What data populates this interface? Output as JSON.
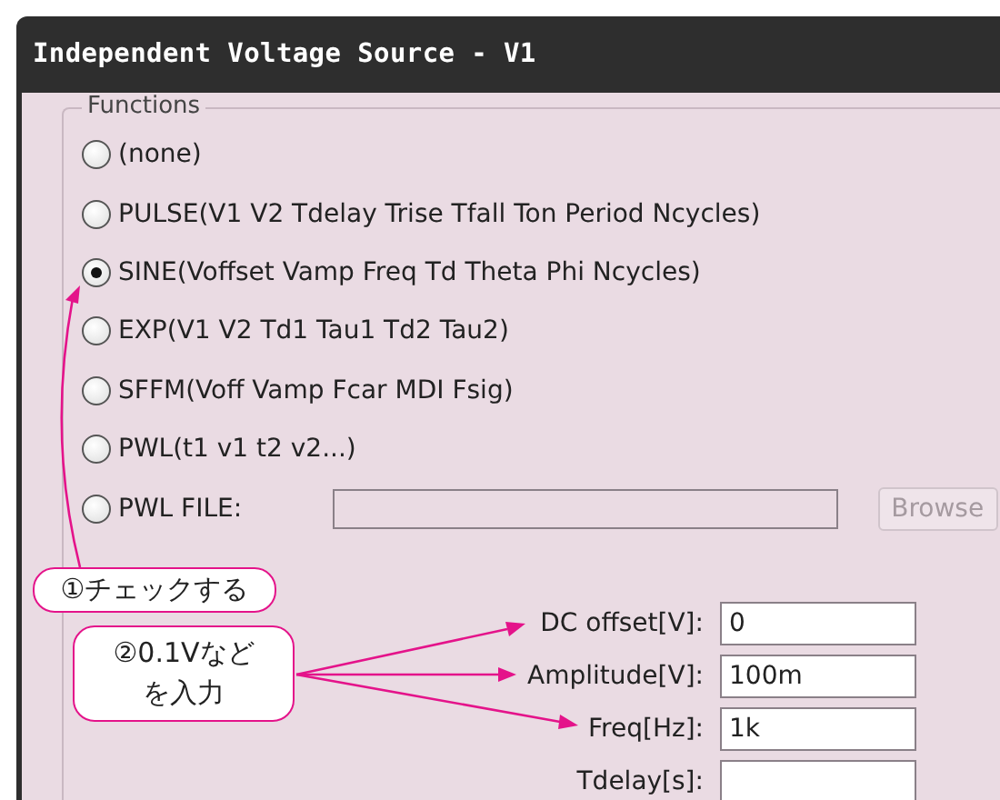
{
  "window": {
    "title": "Independent Voltage Source - V1"
  },
  "functions": {
    "label": "Functions",
    "options": [
      {
        "kind": "radio",
        "label": "(none)",
        "selected": false
      },
      {
        "kind": "radio",
        "label": "PULSE(V1 V2 Tdelay Trise Tfall Ton Period Ncycles)",
        "selected": false
      },
      {
        "kind": "radio",
        "label": "SINE(Voffset Vamp Freq Td Theta Phi Ncycles)",
        "selected": true
      },
      {
        "kind": "radio",
        "label": "EXP(V1 V2 Td1 Tau1 Td2 Tau2)",
        "selected": false
      },
      {
        "kind": "radio",
        "label": "SFFM(Voff Vamp Fcar MDI Fsig)",
        "selected": false
      },
      {
        "kind": "radio",
        "label": "PWL(t1 v1 t2 v2...)",
        "selected": false
      },
      {
        "kind": "file",
        "label": "PWL FILE:",
        "selected": false,
        "button": {
          "label": "Browse",
          "disabled": true
        }
      }
    ]
  },
  "params": [
    {
      "label": "DC offset[V]:",
      "value": "0"
    },
    {
      "label": "Amplitude[V]:",
      "value": "100m"
    },
    {
      "label": "Freq[Hz]:",
      "value": "1k"
    },
    {
      "label": "Tdelay[s]:"
    }
  ],
  "annotations": [
    {
      "kind": "check",
      "text": "①チェックする"
    },
    {
      "kind": "input",
      "text": "②0.1Vなどを入力"
    }
  ]
}
